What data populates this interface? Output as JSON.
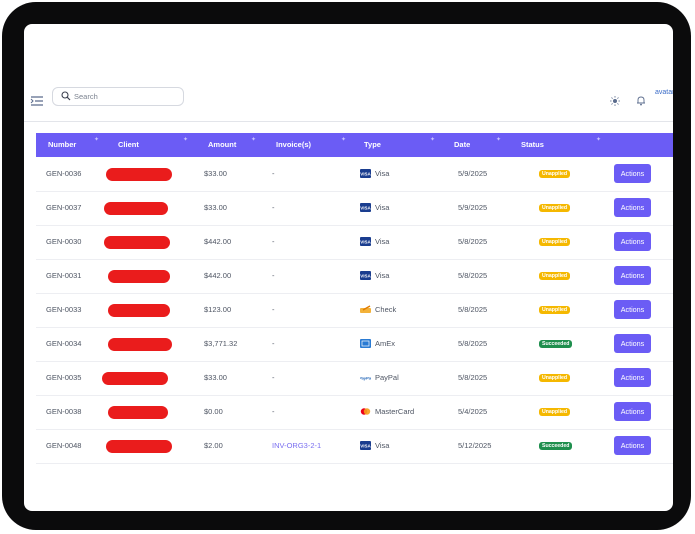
{
  "search": {
    "placeholder": "Search"
  },
  "header": {
    "avatar_alt": "avatar"
  },
  "table": {
    "columns": [
      "Number",
      "Client",
      "Amount",
      "Invoice(s)",
      "Type",
      "Date",
      "Status"
    ],
    "rows": [
      {
        "number": "GEN-0036",
        "amount": "$33.00",
        "invoice": "-",
        "type": "Visa",
        "type_icon": "visa-icon",
        "date": "5/9/2025",
        "status": "Unapplied",
        "action": "Actions"
      },
      {
        "number": "GEN-0037",
        "amount": "$33.00",
        "invoice": "-",
        "type": "Visa",
        "type_icon": "visa-icon",
        "date": "5/9/2025",
        "status": "Unapplied",
        "action": "Actions"
      },
      {
        "number": "GEN-0030",
        "amount": "$442.00",
        "invoice": "-",
        "type": "Visa",
        "type_icon": "visa-icon",
        "date": "5/8/2025",
        "status": "Unapplied",
        "action": "Actions"
      },
      {
        "number": "GEN-0031",
        "amount": "$442.00",
        "invoice": "-",
        "type": "Visa",
        "type_icon": "visa-icon",
        "date": "5/8/2025",
        "status": "Unapplied",
        "action": "Actions"
      },
      {
        "number": "GEN-0033",
        "amount": "$123.00",
        "invoice": "-",
        "type": "Check",
        "type_icon": "check-icon",
        "date": "5/8/2025",
        "status": "Unapplied",
        "action": "Actions"
      },
      {
        "number": "GEN-0034",
        "amount": "$3,771.32",
        "invoice": "-",
        "type": "AmEx",
        "type_icon": "amex-icon",
        "date": "5/8/2025",
        "status": "Succeeded",
        "action": "Actions"
      },
      {
        "number": "GEN-0035",
        "amount": "$33.00",
        "invoice": "-",
        "type": "PayPal",
        "type_icon": "paypal-icon",
        "date": "5/8/2025",
        "status": "Unapplied",
        "action": "Actions"
      },
      {
        "number": "GEN-0038",
        "amount": "$0.00",
        "invoice": "-",
        "type": "MasterCard",
        "type_icon": "mastercard-icon",
        "date": "5/4/2025",
        "status": "Unapplied",
        "action": "Actions"
      },
      {
        "number": "GEN-0048",
        "amount": "$2.00",
        "invoice": "INV-ORG3-2-1",
        "type": "Visa",
        "type_icon": "visa-icon",
        "date": "5/12/2025",
        "status": "Succeeded",
        "action": "Actions"
      }
    ]
  },
  "colors": {
    "accent": "#6b5cf5",
    "unapplied": "#f5b800",
    "succeeded": "#1f8f4e",
    "redaction": "#ea1c1c"
  }
}
